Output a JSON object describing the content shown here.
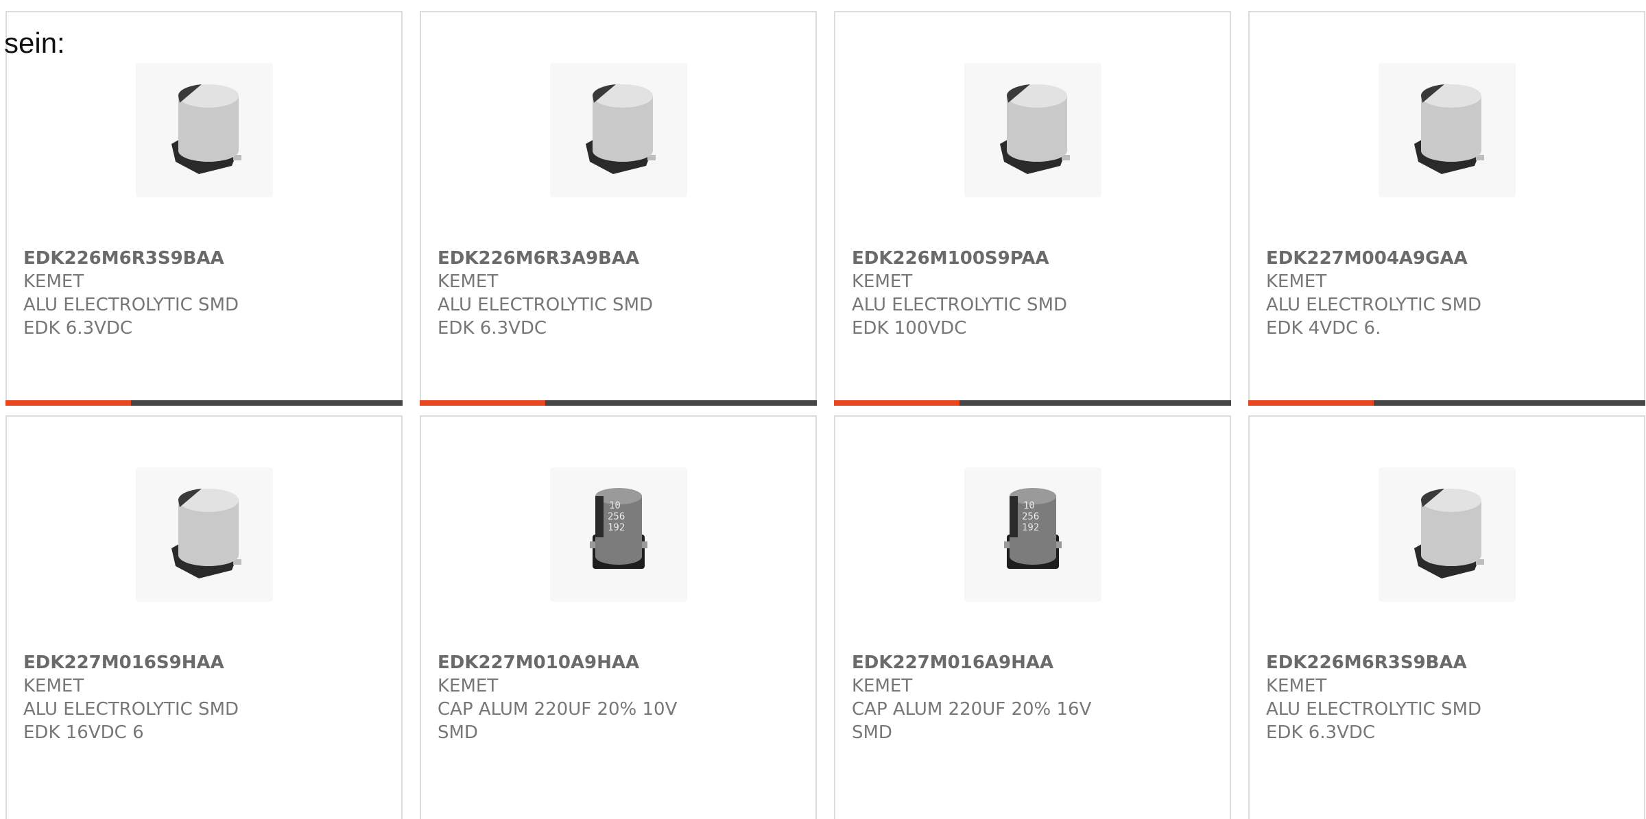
{
  "heading": "sein:",
  "colors": {
    "accent": "#e8461e",
    "bar": "#464646",
    "border": "#dcdcdc",
    "text": "#777777"
  },
  "products": [
    {
      "part": "EDK226M6R3S9BAA",
      "maker": "KEMET",
      "description": "ALU ELECTROLYTIC SMD EDK 6.3VDC",
      "image": "capacitor-plain-icon"
    },
    {
      "part": "EDK226M6R3A9BAA",
      "maker": "KEMET",
      "description": "ALU ELECTROLYTIC SMD EDK 6.3VDC",
      "image": "capacitor-plain-icon"
    },
    {
      "part": "EDK226M100S9PAA",
      "maker": "KEMET",
      "description": "ALU ELECTROLYTIC SMD EDK 100VDC",
      "image": "capacitor-plain-icon"
    },
    {
      "part": "EDK227M004A9GAA",
      "maker": "KEMET",
      "description": "ALU ELECTROLYTIC SMD EDK 4VDC 6.",
      "image": "capacitor-plain-icon"
    },
    {
      "part": "EDK227M016S9HAA",
      "maker": "KEMET",
      "description": "ALU ELECTROLYTIC SMD EDK 16VDC 6",
      "image": "capacitor-plain-icon"
    },
    {
      "part": "EDK227M010A9HAA",
      "maker": "KEMET",
      "description": "CAP ALUM 220UF 20% 10V SMD",
      "image": "capacitor-marked-icon"
    },
    {
      "part": "EDK227M016A9HAA",
      "maker": "KEMET",
      "description": "CAP ALUM 220UF 20% 16V SMD",
      "image": "capacitor-marked-icon"
    },
    {
      "part": "EDK226M6R3S9BAA",
      "maker": "KEMET",
      "description": "ALU ELECTROLYTIC SMD EDK 6.3VDC",
      "image": "capacitor-plain-icon"
    }
  ]
}
